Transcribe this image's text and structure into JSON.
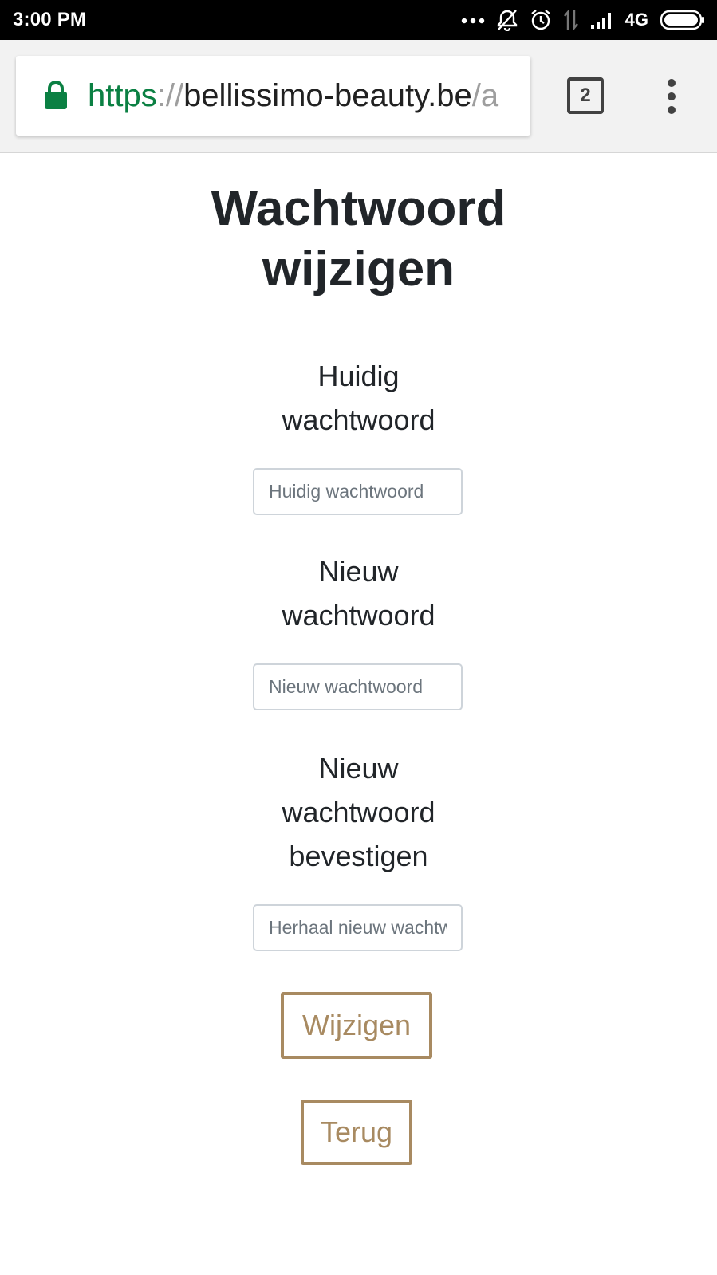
{
  "status_bar": {
    "time": "3:00 PM",
    "network": "4G",
    "icons": [
      "more-dots-icon",
      "notifications-off-icon",
      "alarm-icon",
      "data-transfer-icon",
      "signal-icon",
      "battery-icon"
    ]
  },
  "browser": {
    "url": {
      "scheme": "https",
      "separator": "://",
      "host": "bellissimo-beauty.be",
      "path_start": "/a"
    },
    "tab_count": "2",
    "secure": true
  },
  "form": {
    "title_line1": "Wachtwoord",
    "title_line2": "wijzigen",
    "fields": [
      {
        "label_lines": [
          "Huidig",
          "wachtwoord"
        ],
        "placeholder": "Huidig wachtwoord",
        "value": ""
      },
      {
        "label_lines": [
          "Nieuw",
          "wachtwoord"
        ],
        "placeholder": "Nieuw wachtwoord",
        "value": ""
      },
      {
        "label_lines": [
          "Nieuw",
          "wachtwoord",
          "bevestigen"
        ],
        "placeholder": "Herhaal nieuw wachtwoord",
        "value": ""
      }
    ],
    "submit_label": "Wijzigen",
    "back_label": "Terug"
  },
  "colors": {
    "accent": "#a88a61",
    "secure_green": "#0b8043",
    "text": "#212529"
  }
}
